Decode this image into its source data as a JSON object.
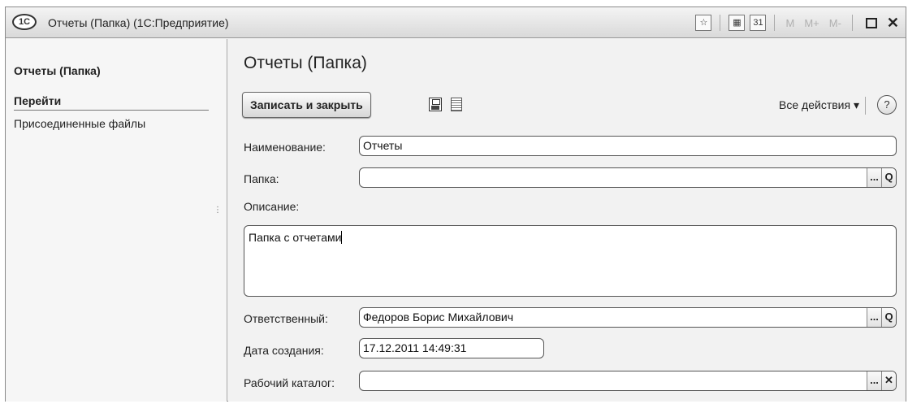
{
  "window": {
    "logo_text": "1С",
    "title": "Отчеты (Папка)  (1С:Предприятие)",
    "toolbar": {
      "favorites_icon": "☆",
      "calculator_icon": "▦",
      "calendar_icon": "31",
      "mem_m": "M",
      "mem_plus": "M+",
      "mem_minus": "M-",
      "close_glyph": "✕"
    }
  },
  "sidebar": {
    "title": "Отчеты (Папка)",
    "section": "Перейти",
    "items": [
      {
        "label": "Присоединенные файлы"
      }
    ],
    "grip": "⋮"
  },
  "form": {
    "title": "Отчеты (Папка)",
    "toolbar": {
      "save_close_label": "Записать и закрыть",
      "all_actions_label": "Все действия ▾",
      "help_label": "?"
    },
    "fields": {
      "name": {
        "label": "Наименование:",
        "value": "Отчеты"
      },
      "folder": {
        "label": "Папка:",
        "value": ""
      },
      "description": {
        "label": "Описание:",
        "value": "Папка с отчетами"
      },
      "responsible": {
        "label": "Ответственный:",
        "value": "Федоров Борис Михайлович"
      },
      "created": {
        "label": "Дата создания:",
        "value": "17.12.2011 14:49:31"
      },
      "workdir": {
        "label": "Рабочий каталог:",
        "value": ""
      }
    },
    "buttons": {
      "select": "...",
      "open": "Q",
      "clear": "✕"
    }
  }
}
